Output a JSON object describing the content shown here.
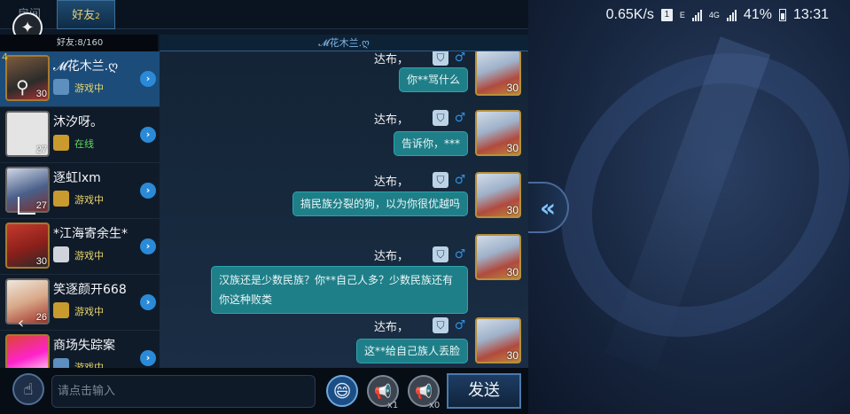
{
  "status_bar": {
    "speed": "0.65K/s",
    "sim": "1",
    "net1": "E",
    "net2": "4G",
    "battery": "41%",
    "time": "13:31"
  },
  "tabs": {
    "room": "房间",
    "friends": "好友",
    "friends_badge": "2"
  },
  "friend_count": "好友:8/160",
  "friends": [
    {
      "name": "𝓜花木兰.ღ",
      "status": "游戏中",
      "level": "30",
      "corner": "4"
    },
    {
      "name": "沐汐呀。",
      "status": "在线",
      "level": "27",
      "corner": ""
    },
    {
      "name": "逐虹lxm",
      "status": "游戏中",
      "level": "27",
      "corner": ""
    },
    {
      "name": "*江海寄余生*",
      "status": "游戏中",
      "level": "30",
      "corner": ""
    },
    {
      "name": "笑逐颜开668",
      "status": "游戏中",
      "level": "26",
      "corner": ""
    },
    {
      "name": "商场失踪案",
      "status": "游戏中",
      "level": "",
      "corner": ""
    }
  ],
  "chat": {
    "title": "𝓜花木兰.ღ",
    "messages": [
      {
        "sender": "达布，",
        "text": "你**骂什么",
        "level": "30"
      },
      {
        "sender": "达布，",
        "text": "告诉你，***",
        "level": "30"
      },
      {
        "sender": "达布，",
        "text": "搞民族分裂的狗，以为你很优越吗",
        "level": "30"
      },
      {
        "sender": "达布，",
        "text": "汉族还是少数民族？你**自己人多？少数民族还有你这种败类",
        "level": "30"
      },
      {
        "sender": "达布，",
        "text": "这**给自己族人丢脸",
        "level": "30"
      }
    ]
  },
  "input": {
    "placeholder": "请点击输入",
    "send_label": "发送",
    "horn1_count": "x1",
    "horn2_count": "x0"
  },
  "colors": {
    "bubble": "#1f7f88",
    "selected_row": "#1c4c7a",
    "ingame": "#e8d66a",
    "online": "#5fdc5f"
  }
}
